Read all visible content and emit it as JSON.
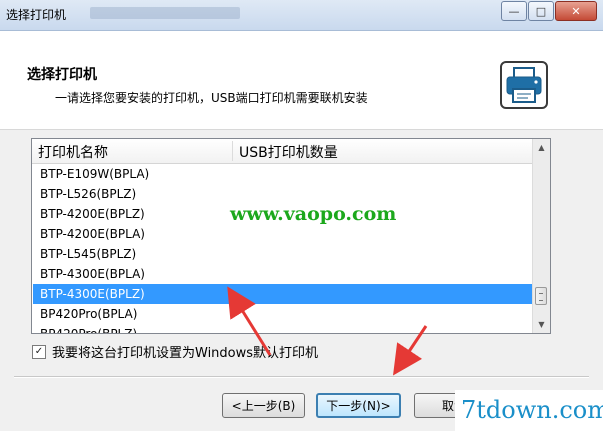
{
  "window": {
    "title": "选择打印机",
    "controls": {
      "minimize": "—",
      "maximize": "□",
      "close": "✕"
    }
  },
  "header": {
    "title": "选择打印机",
    "subtitle": "一请选择您要安装的打印机，USB端口打印机需要联机安装",
    "icon": "printer-icon"
  },
  "list": {
    "columns": [
      "打印机名称",
      "USB打印机数量"
    ],
    "rows": [
      {
        "name": "BTP-E109W(BPLA)",
        "count": ""
      },
      {
        "name": "BTP-L526(BPLZ)",
        "count": ""
      },
      {
        "name": "BTP-4200E(BPLZ)",
        "count": ""
      },
      {
        "name": "BTP-4200E(BPLA)",
        "count": ""
      },
      {
        "name": "BTP-L545(BPLZ)",
        "count": ""
      },
      {
        "name": "BTP-4300E(BPLA)",
        "count": ""
      },
      {
        "name": "BTP-4300E(BPLZ)",
        "count": ""
      },
      {
        "name": "BP420Pro(BPLA)",
        "count": ""
      },
      {
        "name": "BP420Pro(BPLZ)",
        "count": ""
      }
    ],
    "selected_index": 6
  },
  "checkbox": {
    "label": "我要将这台打印机设置为Windows默认打印机",
    "checked": true,
    "mark": "✓"
  },
  "buttons": {
    "back": "<上一步(B)",
    "next": "下一步(N)>",
    "cancel": "取消"
  },
  "watermarks": {
    "center": "www.vaopo.com",
    "corner": "7tdown.com"
  },
  "colors": {
    "selection": "#3399ff",
    "arrow": "#e53935",
    "watermark_center": "#1ca81c",
    "watermark_corner": "#1a8fc9"
  }
}
